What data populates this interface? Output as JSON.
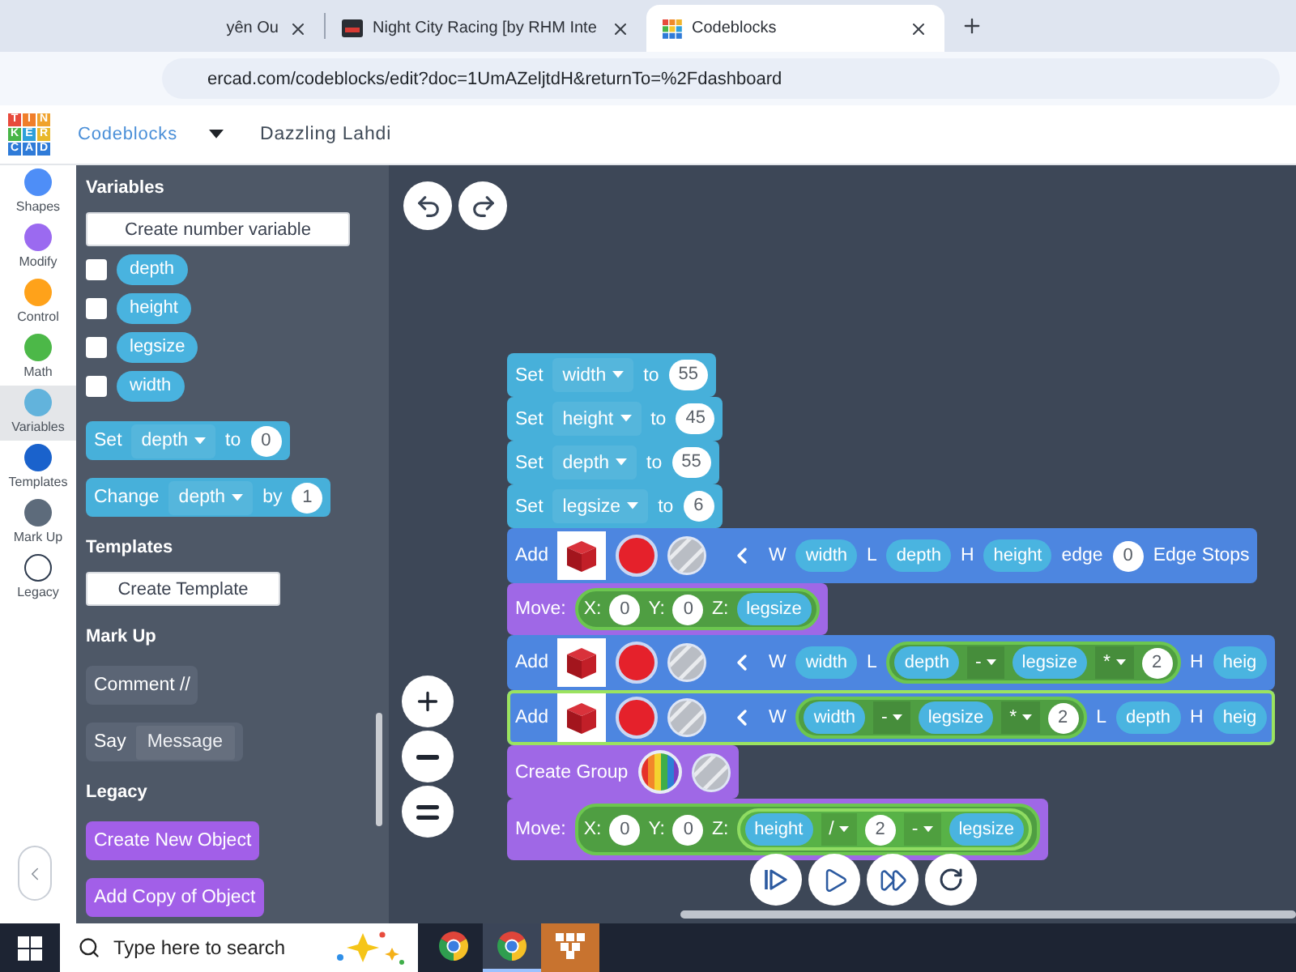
{
  "browser": {
    "tabs": [
      {
        "title": "yên Ou",
        "kind": "plain",
        "selected": false
      },
      {
        "title": "Night City Racing [by RHM Inte",
        "kind": "game",
        "selected": false
      },
      {
        "title": "Codeblocks",
        "kind": "app",
        "selected": true
      }
    ],
    "url": "ercad.com/codeblocks/edit?doc=1UmAZeljtdH&returnTo=%2Fdashboard"
  },
  "header": {
    "logo_letters": [
      "T",
      "I",
      "N",
      "K",
      "E",
      "R",
      "C",
      "A",
      "D"
    ],
    "product": "Codeblocks",
    "design_name": "Dazzling Lahdi"
  },
  "categories": [
    {
      "label": "Shapes",
      "color": "#4e8ef7",
      "selected": false
    },
    {
      "label": "Modify",
      "color": "#9b6af0",
      "selected": false
    },
    {
      "label": "Control",
      "color": "#ffa21a",
      "selected": false
    },
    {
      "label": "Math",
      "color": "#4cb848",
      "selected": false
    },
    {
      "label": "Variables",
      "color": "#62b3dc",
      "selected": true
    },
    {
      "label": "Templates",
      "color": "#1a62cc",
      "selected": false
    },
    {
      "label": "Mark Up",
      "color": "#5d6b7b",
      "selected": false
    },
    {
      "label": "Legacy",
      "color": "#ffffff",
      "selected": false
    }
  ],
  "palette": [
    {
      "title": "Variables",
      "items": [
        {
          "kind": "button",
          "label": "Create number variable"
        },
        {
          "kind": "variable",
          "name": "depth",
          "checked": false
        },
        {
          "kind": "variable",
          "name": "height",
          "checked": false
        },
        {
          "kind": "variable",
          "name": "legsize",
          "checked": false
        },
        {
          "kind": "variable",
          "name": "width",
          "checked": false
        },
        {
          "kind": "block",
          "color": "#47b0da",
          "parts": [
            {
              "kind": "text",
              "text": "Set"
            },
            {
              "kind": "dropdown",
              "text": "depth"
            },
            {
              "kind": "text",
              "text": "to"
            },
            {
              "kind": "number",
              "text": "0"
            }
          ]
        },
        {
          "kind": "block",
          "color": "#47b0da",
          "parts": [
            {
              "kind": "text",
              "text": "Change"
            },
            {
              "kind": "dropdown",
              "text": "depth"
            },
            {
              "kind": "text",
              "text": "by"
            },
            {
              "kind": "number",
              "text": "1"
            }
          ]
        }
      ]
    },
    {
      "title": "Templates",
      "items": [
        {
          "kind": "button",
          "label": "Create Template"
        }
      ]
    },
    {
      "title": "Mark Up",
      "items": [
        {
          "kind": "block",
          "color": "#5b6575",
          "parts": [
            {
              "kind": "text",
              "text": "Comment //"
            }
          ]
        },
        {
          "kind": "block",
          "color": "#5b6575",
          "parts": [
            {
              "kind": "text",
              "text": "Say"
            },
            {
              "kind": "field",
              "text": "Message"
            }
          ]
        }
      ]
    },
    {
      "title": "Legacy",
      "items": [
        {
          "kind": "block",
          "color": "#a25fe8",
          "parts": [
            {
              "kind": "text",
              "text": "Create New Object"
            }
          ]
        },
        {
          "kind": "block",
          "color": "#a25fe8",
          "parts": [
            {
              "kind": "text",
              "text": "Add Copy of Object"
            }
          ]
        }
      ]
    }
  ],
  "canvas": {
    "blocks": [
      {
        "color": "#47b0da",
        "selected": false,
        "parts": [
          {
            "kind": "text",
            "text": "Set"
          },
          {
            "kind": "dropdown",
            "text": "width"
          },
          {
            "kind": "text",
            "text": "to"
          },
          {
            "kind": "number",
            "text": "55"
          }
        ]
      },
      {
        "color": "#47b0da",
        "selected": false,
        "parts": [
          {
            "kind": "text",
            "text": "Set"
          },
          {
            "kind": "dropdown",
            "text": "height"
          },
          {
            "kind": "text",
            "text": "to"
          },
          {
            "kind": "number",
            "text": "45"
          }
        ]
      },
      {
        "color": "#47b0da",
        "selected": false,
        "parts": [
          {
            "kind": "text",
            "text": "Set"
          },
          {
            "kind": "dropdown",
            "text": "depth"
          },
          {
            "kind": "text",
            "text": "to"
          },
          {
            "kind": "number",
            "text": "55"
          }
        ]
      },
      {
        "color": "#47b0da",
        "selected": false,
        "parts": [
          {
            "kind": "text",
            "text": "Set"
          },
          {
            "kind": "dropdown",
            "text": "legsize"
          },
          {
            "kind": "text",
            "text": "to"
          },
          {
            "kind": "number",
            "text": "6"
          }
        ]
      },
      {
        "color": "#4d86e0",
        "selected": false,
        "parts": [
          {
            "kind": "text",
            "text": "Add"
          },
          {
            "kind": "shape"
          },
          {
            "kind": "color",
            "color": "#e5212b"
          },
          {
            "kind": "hole"
          },
          {
            "kind": "chevron"
          },
          {
            "kind": "text",
            "text": "W"
          },
          {
            "kind": "var",
            "text": "width"
          },
          {
            "kind": "text",
            "text": "L"
          },
          {
            "kind": "var",
            "text": "depth"
          },
          {
            "kind": "text",
            "text": "H"
          },
          {
            "kind": "var",
            "text": "height"
          },
          {
            "kind": "text",
            "text": "edge"
          },
          {
            "kind": "number",
            "text": "0"
          },
          {
            "kind": "text",
            "text": "Edge Stops"
          }
        ]
      },
      {
        "color": "#9f68e6",
        "selected": false,
        "parts": [
          {
            "kind": "text",
            "text": "Move:"
          },
          {
            "kind": "math",
            "parts": [
              {
                "kind": "text",
                "text": "X:"
              },
              {
                "kind": "number",
                "text": "0"
              },
              {
                "kind": "text",
                "text": "Y:"
              },
              {
                "kind": "number",
                "text": "0"
              },
              {
                "kind": "text",
                "text": "Z:"
              },
              {
                "kind": "var",
                "text": "legsize"
              }
            ]
          }
        ]
      },
      {
        "color": "#4d86e0",
        "selected": false,
        "parts": [
          {
            "kind": "text",
            "text": "Add"
          },
          {
            "kind": "shape"
          },
          {
            "kind": "color",
            "color": "#e5212b"
          },
          {
            "kind": "hole"
          },
          {
            "kind": "chevron"
          },
          {
            "kind": "text",
            "text": "W"
          },
          {
            "kind": "var",
            "text": "width"
          },
          {
            "kind": "text",
            "text": "L"
          },
          {
            "kind": "math",
            "parts": [
              {
                "kind": "var",
                "text": "depth"
              },
              {
                "kind": "operator",
                "text": "-"
              },
              {
                "kind": "var",
                "text": "legsize"
              },
              {
                "kind": "operator",
                "text": "*"
              },
              {
                "kind": "number",
                "text": "2"
              }
            ]
          },
          {
            "kind": "text",
            "text": "H"
          },
          {
            "kind": "var",
            "text": "heig"
          }
        ]
      },
      {
        "color": "#4d86e0",
        "selected": true,
        "parts": [
          {
            "kind": "text",
            "text": "Add"
          },
          {
            "kind": "shape"
          },
          {
            "kind": "color",
            "color": "#e5212b"
          },
          {
            "kind": "hole"
          },
          {
            "kind": "chevron"
          },
          {
            "kind": "text",
            "text": "W"
          },
          {
            "kind": "math",
            "parts": [
              {
                "kind": "var",
                "text": "width"
              },
              {
                "kind": "operator",
                "text": "-"
              },
              {
                "kind": "var",
                "text": "legsize"
              },
              {
                "kind": "operator",
                "text": "*"
              },
              {
                "kind": "number",
                "text": "2"
              }
            ]
          },
          {
            "kind": "text",
            "text": "L"
          },
          {
            "kind": "var",
            "text": "depth"
          },
          {
            "kind": "text",
            "text": "H"
          },
          {
            "kind": "var",
            "text": "heig"
          }
        ]
      },
      {
        "color": "#9f68e6",
        "selected": false,
        "parts": [
          {
            "kind": "text",
            "text": "Create Group"
          },
          {
            "kind": "rainbow"
          },
          {
            "kind": "hole"
          }
        ]
      },
      {
        "color": "#9f68e6",
        "selected": false,
        "parts": [
          {
            "kind": "text",
            "text": "Move:"
          },
          {
            "kind": "math",
            "parts": [
              {
                "kind": "text",
                "text": "X:"
              },
              {
                "kind": "number",
                "text": "0"
              },
              {
                "kind": "text",
                "text": "Y:"
              },
              {
                "kind": "number",
                "text": "0"
              },
              {
                "kind": "text",
                "text": "Z:"
              },
              {
                "kind": "math",
                "parts": [
                  {
                    "kind": "var",
                    "text": "height"
                  },
                  {
                    "kind": "operator",
                    "text": "/"
                  },
                  {
                    "kind": "number",
                    "text": "2"
                  },
                  {
                    "kind": "operator",
                    "text": "-"
                  },
                  {
                    "kind": "var",
                    "text": "legsize"
                  }
                ]
              }
            ]
          }
        ]
      }
    ]
  },
  "taskbar": {
    "search": {
      "placeholder": "Type here to search"
    },
    "apps": [
      {
        "kind": "browser",
        "selected": false
      },
      {
        "kind": "browser-profile",
        "selected": true
      },
      {
        "kind": "app",
        "selected": false
      }
    ]
  }
}
